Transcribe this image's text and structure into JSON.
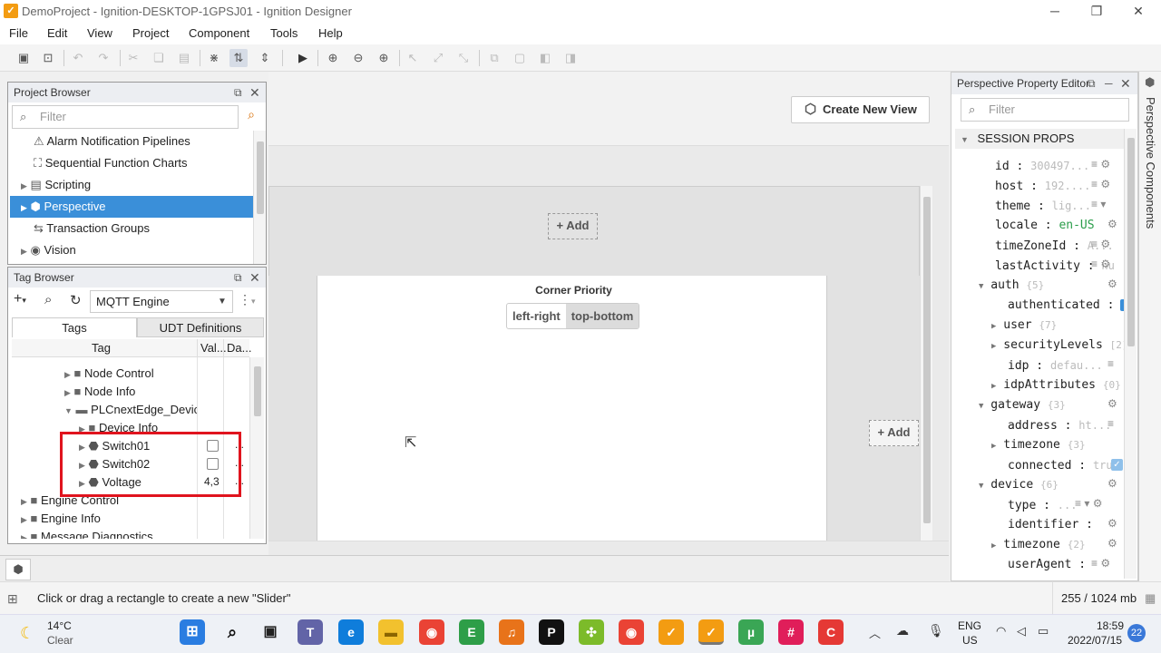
{
  "window": {
    "title": "DemoProject - Ignition-DESKTOP-1GPSJ01 - Ignition Designer",
    "app_icon": "ignition-icon"
  },
  "menu": [
    "File",
    "Edit",
    "View",
    "Project",
    "Component",
    "Tools",
    "Help"
  ],
  "toolbar": {
    "icons": [
      "save-icon",
      "save-all-icon",
      "undo-icon",
      "redo-icon",
      "cut-icon",
      "copy-icon",
      "paste-icon",
      "no-snap-icon",
      "align-icon",
      "distribute-icon",
      "play-icon",
      "zoom-fit-icon",
      "zoom-out-icon",
      "zoom-in-icon",
      "select-icon",
      "bend-icon",
      "unbend-icon",
      "group-icon",
      "ungroup-icon",
      "front-icon",
      "back-icon"
    ]
  },
  "main": {
    "create_new_view": "Create New View",
    "add_top": "Add",
    "add_right": "Add",
    "corner_priority_label": "Corner Priority",
    "corner_options": [
      "left-right",
      "top-bottom"
    ],
    "corner_selected": "top-bottom"
  },
  "project_browser": {
    "title": "Project Browser",
    "filter_placeholder": "Filter",
    "items": [
      {
        "label": "Alarm Notification Pipelines",
        "icon": "alarm-pipeline-icon",
        "expandable": false
      },
      {
        "label": "Sequential Function Charts",
        "icon": "sfc-icon",
        "expandable": false
      },
      {
        "label": "Scripting",
        "icon": "script-icon",
        "expandable": true
      },
      {
        "label": "Perspective",
        "icon": "perspective-icon",
        "expandable": true,
        "selected": true
      },
      {
        "label": "Transaction Groups",
        "icon": "transaction-icon",
        "expandable": false
      },
      {
        "label": "Vision",
        "icon": "vision-icon",
        "expandable": true
      }
    ]
  },
  "tag_browser": {
    "title": "Tag Browser",
    "provider": "MQTT Engine",
    "tabs": [
      "Tags",
      "UDT Definitions"
    ],
    "columns": [
      "Tag",
      "Val...",
      "Da..."
    ],
    "rows": [
      {
        "label": "Node Control",
        "indent": 1,
        "type": "folder",
        "val": "",
        "da": ""
      },
      {
        "label": "Node Info",
        "indent": 1,
        "type": "folder",
        "val": "",
        "da": ""
      },
      {
        "label": "PLCnextEdge_Devic",
        "indent": 1,
        "type": "folder-open",
        "val": "",
        "da": ""
      },
      {
        "label": "Device Info",
        "indent": 2,
        "type": "folder",
        "val": "",
        "da": ""
      },
      {
        "label": "Switch01",
        "indent": 2,
        "type": "tag",
        "val": "checkbox",
        "da": "..."
      },
      {
        "label": "Switch02",
        "indent": 2,
        "type": "tag",
        "val": "checkbox",
        "da": "..."
      },
      {
        "label": "Voltage",
        "indent": 2,
        "type": "tag",
        "val": "4,3",
        "da": "..."
      },
      {
        "label": "Engine Control",
        "indent": 0,
        "type": "folder",
        "val": "",
        "da": ""
      },
      {
        "label": "Engine Info",
        "indent": 0,
        "type": "folder",
        "val": "",
        "da": ""
      },
      {
        "label": "Message Diagnostics",
        "indent": 0,
        "type": "folder",
        "val": "",
        "da": ""
      }
    ]
  },
  "property_editor": {
    "title": "Perspective Property Editor",
    "filter_placeholder": "Filter",
    "section": "SESSION PROPS",
    "props": [
      {
        "key": "id",
        "value": "300497...",
        "indent": 0,
        "caret": ""
      },
      {
        "key": "host",
        "value": "192....",
        "indent": 0,
        "caret": ""
      },
      {
        "key": "theme",
        "value": "lig...",
        "indent": 0,
        "caret": ""
      },
      {
        "key": "locale",
        "value": "en-US",
        "indent": 0,
        "caret": "",
        "green": true
      },
      {
        "key": "timeZoneId",
        "value": "A...",
        "indent": 0,
        "caret": ""
      },
      {
        "key": "lastActivity",
        "value": "nu",
        "indent": 0,
        "caret": ""
      },
      {
        "key": "auth",
        "value": "",
        "count": "{5}",
        "indent": 0,
        "caret": "down"
      },
      {
        "key": "authenticated",
        "value": "",
        "indent": 1,
        "caret": "",
        "check": true
      },
      {
        "key": "user",
        "value": "",
        "count": "{7}",
        "indent": 1,
        "caret": "right"
      },
      {
        "key": "securityLevels",
        "value": "",
        "count": "[2]",
        "indent": 1,
        "caret": "right"
      },
      {
        "key": "idp",
        "value": "defau...",
        "indent": 1,
        "caret": ""
      },
      {
        "key": "idpAttributes",
        "value": "",
        "count": "{0}",
        "indent": 1,
        "caret": "right"
      },
      {
        "key": "gateway",
        "value": "",
        "count": "{3}",
        "indent": 0,
        "caret": "down"
      },
      {
        "key": "address",
        "value": "ht...",
        "indent": 1,
        "caret": ""
      },
      {
        "key": "timezone",
        "value": "",
        "count": "{3}",
        "indent": 1,
        "caret": "right"
      },
      {
        "key": "connected",
        "value": "true",
        "indent": 1,
        "caret": "",
        "check": true
      },
      {
        "key": "device",
        "value": "",
        "count": "{6}",
        "indent": 0,
        "caret": "down"
      },
      {
        "key": "type",
        "value": "...",
        "indent": 1,
        "caret": ""
      },
      {
        "key": "identifier",
        "value": "",
        "indent": 1,
        "caret": ""
      },
      {
        "key": "timezone",
        "value": "",
        "count": "{2}",
        "indent": 1,
        "caret": "right"
      },
      {
        "key": "userAgent",
        "value": "",
        "indent": 1,
        "caret": ""
      }
    ]
  },
  "side_tab": "Perspective Components",
  "status": {
    "message": "Click or drag a rectangle to create a new \"Slider\"",
    "memory": "255 / 1024 mb"
  },
  "taskbar": {
    "weather_temp": "14°C",
    "weather_desc": "Clear",
    "lang": "ENG",
    "region": "US",
    "time": "18:59",
    "date": "2022/07/15",
    "notifications": "22"
  }
}
